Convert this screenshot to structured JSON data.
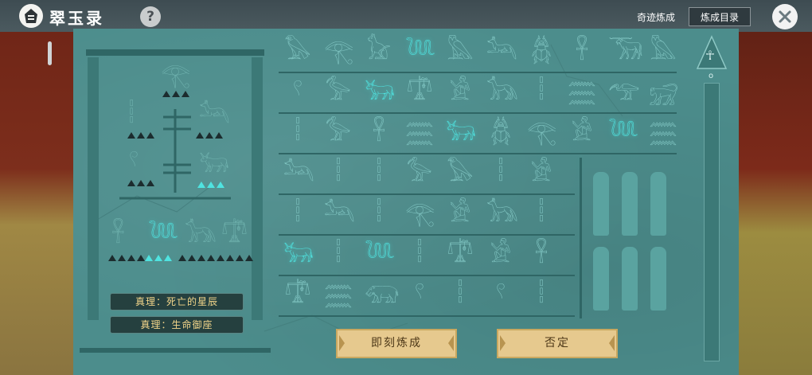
{
  "header": {
    "app_title": "翠玉录",
    "help_label": "?",
    "miracle_label": "奇迹炼成",
    "catalog_label": "炼成目录",
    "close_label": "✕"
  },
  "shrine": {
    "truth_1": "真理：死亡的星辰",
    "truth_2": "真理：生命御座"
  },
  "actions": {
    "transmute_now": "即刻炼成",
    "deny": "否定"
  },
  "pillar": {
    "ankh": "☥",
    "marker": "o"
  },
  "glyph_rows": [
    [
      "𓅃",
      "𓂀",
      "𓃠",
      "𓆙",
      "𓅓",
      "𓃢",
      "𓆣",
      "𓋹",
      "𓃝",
      "𓅓"
    ],
    [
      "𓍢",
      "𓅞",
      "𓃒",
      "𓍝",
      "𓀀",
      "𓃥",
      "𓏪",
      "𓈗",
      "𓅠",
      "𓃸"
    ],
    [
      "𓏪",
      "𓅞",
      "𓋹",
      "𓈗",
      "𓃒",
      "𓆣",
      "𓂀",
      "𓀀",
      "𓆙",
      "𓈗"
    ],
    [
      "𓃢",
      "𓏪",
      "𓏪",
      "𓅞",
      "𓅃",
      "𓏪",
      "𓀀"
    ],
    [
      "𓏪",
      "𓃢",
      "𓏪",
      "𓂀",
      "𓀀",
      "𓃥",
      "𓏪"
    ],
    [
      "𓃒",
      "𓏪",
      "𓆙",
      "𓏪",
      "𓍝",
      "𓀀",
      "𓋹"
    ],
    [
      "𓍝",
      "𓈗",
      "𓃯",
      "𓍢",
      "𓏪",
      "𓍢",
      "𓏪"
    ]
  ],
  "lit_cells": [
    "0-3",
    "1-2",
    "2-4",
    "2-8",
    "5-0",
    "5-2"
  ],
  "colors": {
    "panel": "#4c8d8c",
    "glyph": "#7fc4c1",
    "glyph_lit": "#4fe3e0",
    "button": "#e6c98e",
    "truth_text": "#f2d58a"
  }
}
